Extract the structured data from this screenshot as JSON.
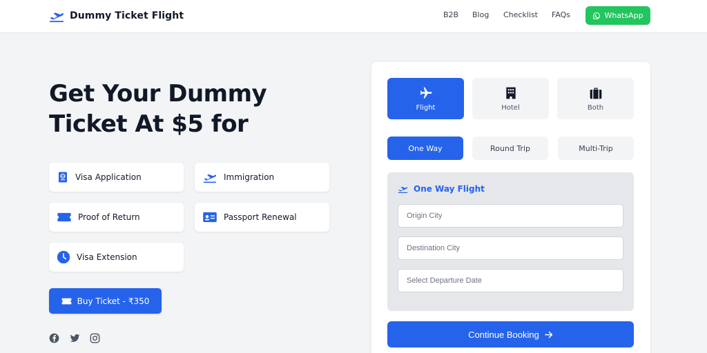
{
  "header": {
    "brand": "Dummy Ticket Flight",
    "nav": [
      {
        "label": "B2B",
        "icon": ""
      },
      {
        "label": "Blog",
        "icon": ""
      },
      {
        "label": "Checklist",
        "icon": ""
      },
      {
        "label": "FAQs",
        "icon": ""
      }
    ],
    "whatsapp_label": "WhatsApp",
    "whatsapp_color": "#22c55e"
  },
  "hero": {
    "title": "Get Your Dummy Ticket At $5 for",
    "features": [
      {
        "label": "Visa Application",
        "icon": "passport-icon"
      },
      {
        "label": "Immigration",
        "icon": "plane-departure-icon"
      },
      {
        "label": "Proof of Return",
        "icon": "ticket-icon"
      },
      {
        "label": "Passport Renewal",
        "icon": "id-card-icon"
      },
      {
        "label": "Visa Extension",
        "icon": "clock-icon"
      }
    ],
    "buy_button": "Buy Ticket - ₹350",
    "social": [
      "facebook-icon",
      "twitter-icon",
      "instagram-icon"
    ]
  },
  "booking": {
    "types": [
      {
        "label": "Flight",
        "icon": "plane-icon",
        "active": true
      },
      {
        "label": "Hotel",
        "icon": "hotel-icon",
        "active": false
      },
      {
        "label": "Both",
        "icon": "suitcase-icon",
        "active": false
      }
    ],
    "trips": [
      {
        "label": "One Way",
        "active": true
      },
      {
        "label": "Round Trip",
        "active": false
      },
      {
        "label": "Multi-Trip",
        "active": false
      }
    ],
    "form_title": "One Way Flight",
    "fields": {
      "origin_placeholder": "Origin City",
      "destination_placeholder": "Destination City",
      "date_placeholder": "Select Departure Date"
    },
    "continue_label": "Continue Booking"
  },
  "colors": {
    "accent": "#2563eb",
    "whatsapp": "#22c55e"
  }
}
